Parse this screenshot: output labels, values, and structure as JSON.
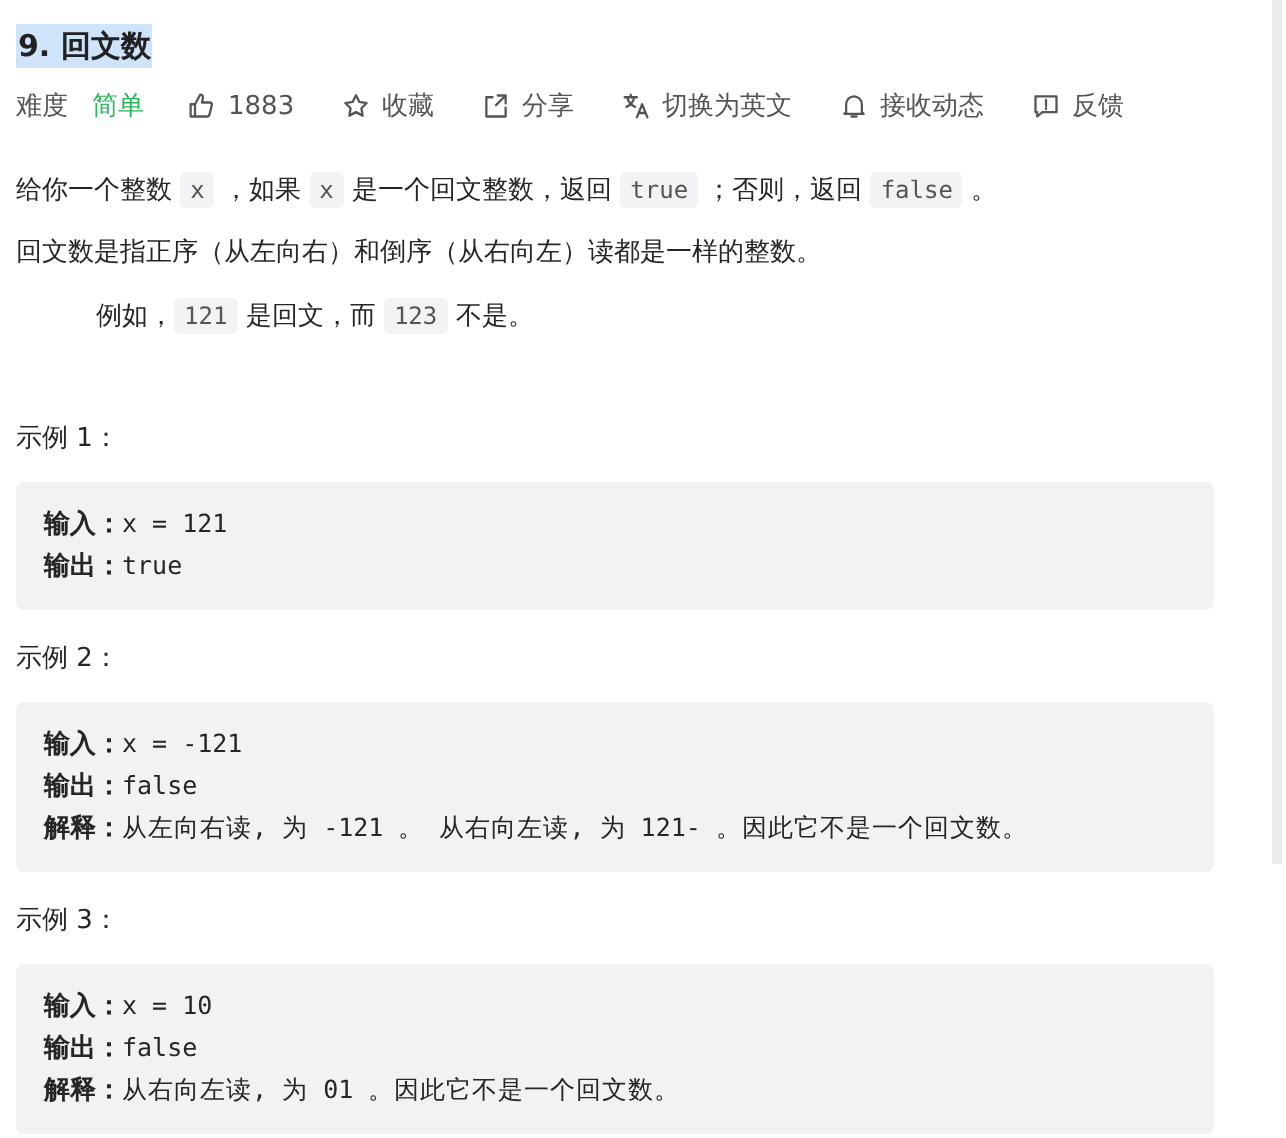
{
  "title": {
    "text": "9. 回文数",
    "highlighted": true
  },
  "meta": {
    "difficulty_label": "难度",
    "difficulty": {
      "text": "简单",
      "color": "#2db55d"
    },
    "actions": [
      {
        "kind": "like",
        "label": "1883"
      },
      {
        "kind": "star",
        "label": "收藏"
      },
      {
        "kind": "share",
        "label": "分享"
      },
      {
        "kind": "translate",
        "label": "切换为英文"
      },
      {
        "kind": "bell",
        "label": "接收动态"
      },
      {
        "kind": "feedback",
        "label": "反馈"
      }
    ]
  },
  "description": [
    {
      "indent": false,
      "segments": [
        {
          "kind": "text",
          "text": "给你一个整数 "
        },
        {
          "kind": "code",
          "text": "x"
        },
        {
          "kind": "text",
          "text": " ，如果 "
        },
        {
          "kind": "code",
          "text": "x"
        },
        {
          "kind": "text",
          "text": " 是一个回文整数，返回 "
        },
        {
          "kind": "code",
          "text": "true"
        },
        {
          "kind": "text",
          "text": " ；否则，返回 "
        },
        {
          "kind": "code",
          "text": "false"
        },
        {
          "kind": "text",
          "text": " 。"
        }
      ]
    },
    {
      "indent": false,
      "segments": [
        {
          "kind": "text",
          "text": "回文数是指正序（从左向右）和倒序（从右向左）读都是一样的整数。"
        }
      ]
    },
    {
      "indent": true,
      "segments": [
        {
          "kind": "text",
          "text": "例如，"
        },
        {
          "kind": "code",
          "text": "121"
        },
        {
          "kind": "text",
          "text": " 是回文，而 "
        },
        {
          "kind": "code",
          "text": "123"
        },
        {
          "kind": "text",
          "text": " 不是。"
        }
      ]
    }
  ],
  "examples": [
    {
      "heading": "示例 1：",
      "lines": [
        {
          "label": "输入：",
          "value": "x = 121"
        },
        {
          "label": "输出：",
          "value": "true"
        }
      ]
    },
    {
      "heading": "示例 2：",
      "lines": [
        {
          "label": "输入：",
          "value": "x = -121"
        },
        {
          "label": "输出：",
          "value": "false"
        },
        {
          "label": "解释：",
          "value": "从左向右读, 为 -121 。 从右向左读, 为 121- 。因此它不是一个回文数。"
        }
      ]
    },
    {
      "heading": "示例 3：",
      "lines": [
        {
          "label": "输入：",
          "value": "x = 10"
        },
        {
          "label": "输出：",
          "value": "false"
        },
        {
          "label": "解释：",
          "value": "从右向左读, 为 01 。因此它不是一个回文数。"
        }
      ]
    }
  ]
}
